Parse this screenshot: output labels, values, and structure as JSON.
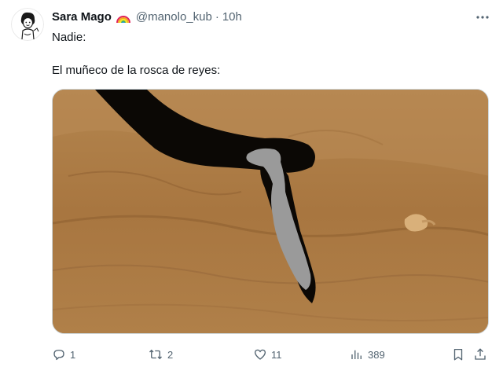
{
  "author": {
    "display_name": "Sara Mago",
    "handle": "@manolo_kub",
    "separator": "·",
    "timestamp": "10h",
    "badge_icon": "rainbow-icon"
  },
  "tweet": {
    "lines": [
      "Nadie:",
      "El muñeco de la rosca de reyes:"
    ]
  },
  "media": {
    "kind": "photo",
    "dominant_color": "#b07d45"
  },
  "actions": {
    "reply": {
      "icon": "reply-icon",
      "count": "1"
    },
    "retweet": {
      "icon": "retweet-icon",
      "count": "2"
    },
    "like": {
      "icon": "heart-icon",
      "count": "11"
    },
    "views": {
      "icon": "views-icon",
      "count": "389"
    },
    "bookmark": {
      "icon": "bookmark-icon"
    },
    "share": {
      "icon": "share-icon"
    }
  },
  "colors": {
    "text_primary": "#0f1419",
    "text_secondary": "#536471",
    "border": "#cfd9de"
  }
}
